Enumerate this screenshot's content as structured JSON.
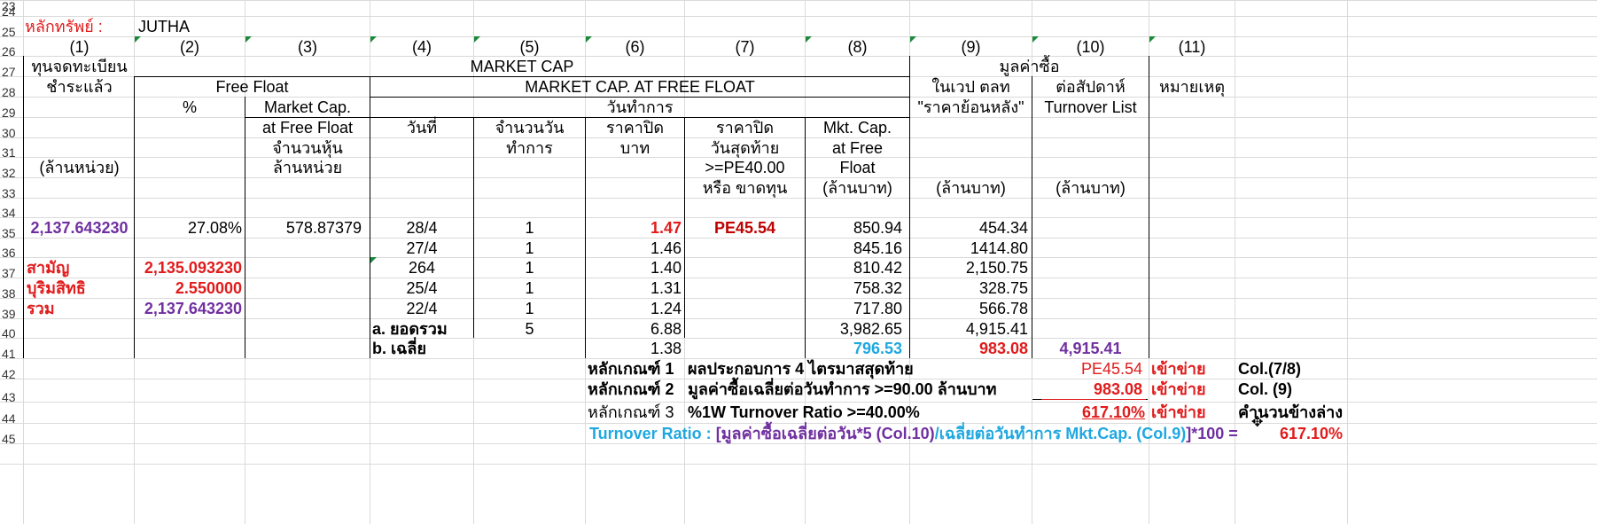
{
  "row_numbers": [
    "23",
    "24",
    "25",
    "26",
    "27",
    "28",
    "29",
    "30",
    "31",
    "32",
    "33",
    "34",
    "35",
    "36",
    "37",
    "38",
    "39",
    "40",
    "41",
    "42",
    "43",
    "44",
    "45"
  ],
  "header": {
    "security_label": "หลักทรัพย์ :",
    "security_value": "JUTHA",
    "col_numbers": [
      "(1)",
      "(2)",
      "(3)",
      "(4)",
      "(5)",
      "(6)",
      "(7)",
      "(8)",
      "(9)",
      "(10)",
      "(11)"
    ],
    "registered_capital_1": "ทุนจดทะเบียน",
    "registered_capital_2": "ชำระแล้ว",
    "registered_capital_unit": "(ล้านหน่วย)",
    "market_cap": "MARKET CAP",
    "market_cap_free_float": "MARKET CAP. AT FREE FLOAT",
    "free_float": "Free Float",
    "trading_days": "วันทำการ",
    "purchase_value": "มูลค่าซื้อ",
    "in_period_1": "ในเวป ตลท",
    "in_period_2": "\"ราคาย้อนหลัง\"",
    "per_week": "ต่อสัปดาห์",
    "turnover_list": "Turnover List",
    "remark": "หมายเหตุ",
    "pct": "%",
    "mcap_ff_1": "Market Cap.",
    "mcap_ff_2": "at Free Float",
    "mcap_ff_3": "จำนวนหุ้น",
    "mcap_ff_4": "ล้านหน่วย",
    "date": "วันที่",
    "days_1": "จำนวนวัน",
    "days_2": "ทำการ",
    "close_1": "ราคาปิด",
    "close_2": "บาท",
    "lastclose_1": "ราคาปิด",
    "lastclose_2": "วันสุดท้าย",
    "lastclose_3": ">=PE40.00",
    "lastclose_4": "หรือ ขาดทุน",
    "mkt_1": "Mkt. Cap.",
    "mkt_2": "at Free",
    "mkt_3": "Float",
    "mkt_4": "(ล้านบาท)",
    "unit9": "(ล้านบาท)",
    "unit10": "(ล้านบาท)"
  },
  "summary": {
    "registered": "2,137.643230",
    "free_float_pct": "27.08%",
    "free_float_shares": "578.87379",
    "pe": "PE45.54",
    "common_label": "สามัญ",
    "common_value": "2,135.093230",
    "preferred_label": "บุริมสิทธิ",
    "preferred_value": "2.550000",
    "total_label": "รวม",
    "total_value": "2,137.643230"
  },
  "rows": [
    {
      "date": "28/4",
      "days": "1",
      "close": "1.47",
      "mcap": "850.94",
      "value": "454.34"
    },
    {
      "date": "27/4",
      "days": "1",
      "close": "1.46",
      "mcap": "845.16",
      "value": "1414.80"
    },
    {
      "date": "264",
      "days": "1",
      "close": "1.40",
      "mcap": "810.42",
      "value": "2,150.75"
    },
    {
      "date": "25/4",
      "days": "1",
      "close": "1.31",
      "mcap": "758.32",
      "value": "328.75"
    },
    {
      "date": "22/4",
      "days": "1",
      "close": "1.24",
      "mcap": "717.80",
      "value": "566.78"
    }
  ],
  "totals": {
    "sum_label": "a.  ยอดรวม",
    "sum_days": "5",
    "sum_close": "6.88",
    "sum_mcap": "3,982.65",
    "sum_value": "4,915.41",
    "avg_label": "b.  เฉลี่ย",
    "avg_close": "1.38",
    "avg_mcap": "796.53",
    "avg_value": "983.08",
    "week_value": "4,915.41"
  },
  "criteria": [
    {
      "label": "หลักเกณฑ์ 1",
      "desc": "ผลประกอบการ 4 ไตรมาสสุดท้าย",
      "value": "PE45.54",
      "result": "เข้าข่าย",
      "ref": "Col.(7/8)"
    },
    {
      "label": "หลักเกณฑ์ 2",
      "desc": "มูลค่าซื้อเฉลี่ยต่อวันทำการ >=90.00 ล้านบาท",
      "value": "983.08",
      "result": "เข้าข่าย",
      "ref": "Col. (9)"
    },
    {
      "label": "หลักเกณฑ์  3",
      "desc": "%1W Turnover Ratio >=40.00%",
      "value": "617.10%",
      "result": "เข้าข่าย",
      "ref": "คำนวนข้างล่าง"
    }
  ],
  "formula": {
    "label": "Turnover Ratio : ",
    "part1": "[มูลค่าซื้อเฉลี่ยต่อวัน*5 (Col.10)",
    "part2": "/เฉลี่ยต่อวันทำการ  Mkt.Cap. (Col.9)",
    "part3": "]*100 =",
    "result": "617.10%"
  },
  "colors": {
    "red": "#e11b1b",
    "purple": "#7030a0",
    "cyan": "#1fa8e0",
    "grid": "#dadada"
  }
}
